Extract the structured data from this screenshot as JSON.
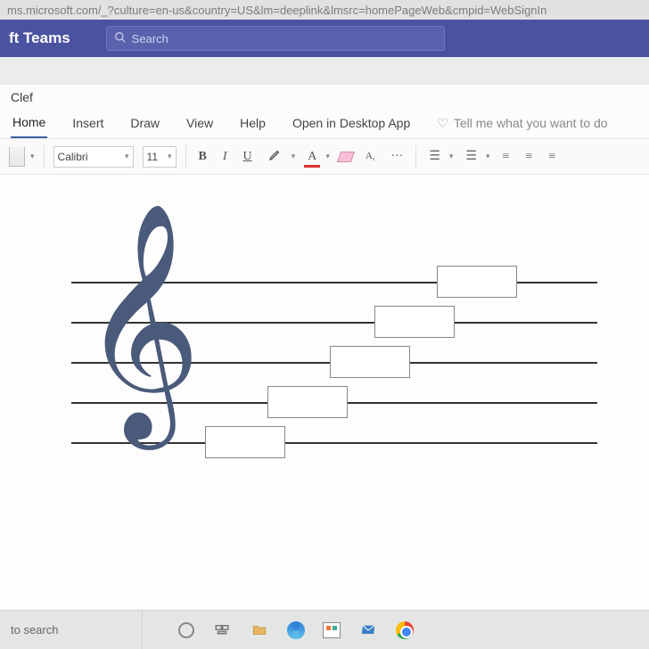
{
  "url": "ms.microsoft.com/_?culture=en-us&country=US&lm=deeplink&lmsrc=homePageWeb&cmpid=WebSignIn",
  "teams": {
    "title": "ft Teams",
    "search_placeholder": "Search"
  },
  "doc_title": "Clef",
  "ribbon": {
    "tabs": [
      "Home",
      "Insert",
      "Draw",
      "View",
      "Help"
    ],
    "active_tab": "Home",
    "open_desktop": "Open in Desktop App",
    "tell_me": "Tell me what you want to do"
  },
  "toolbar": {
    "font": "Calibri",
    "size": "11",
    "bold": "B",
    "italic": "I",
    "underline": "U",
    "fontcolor": "A",
    "styles": "A",
    "more": "···"
  },
  "taskbar": {
    "search": "to search"
  }
}
